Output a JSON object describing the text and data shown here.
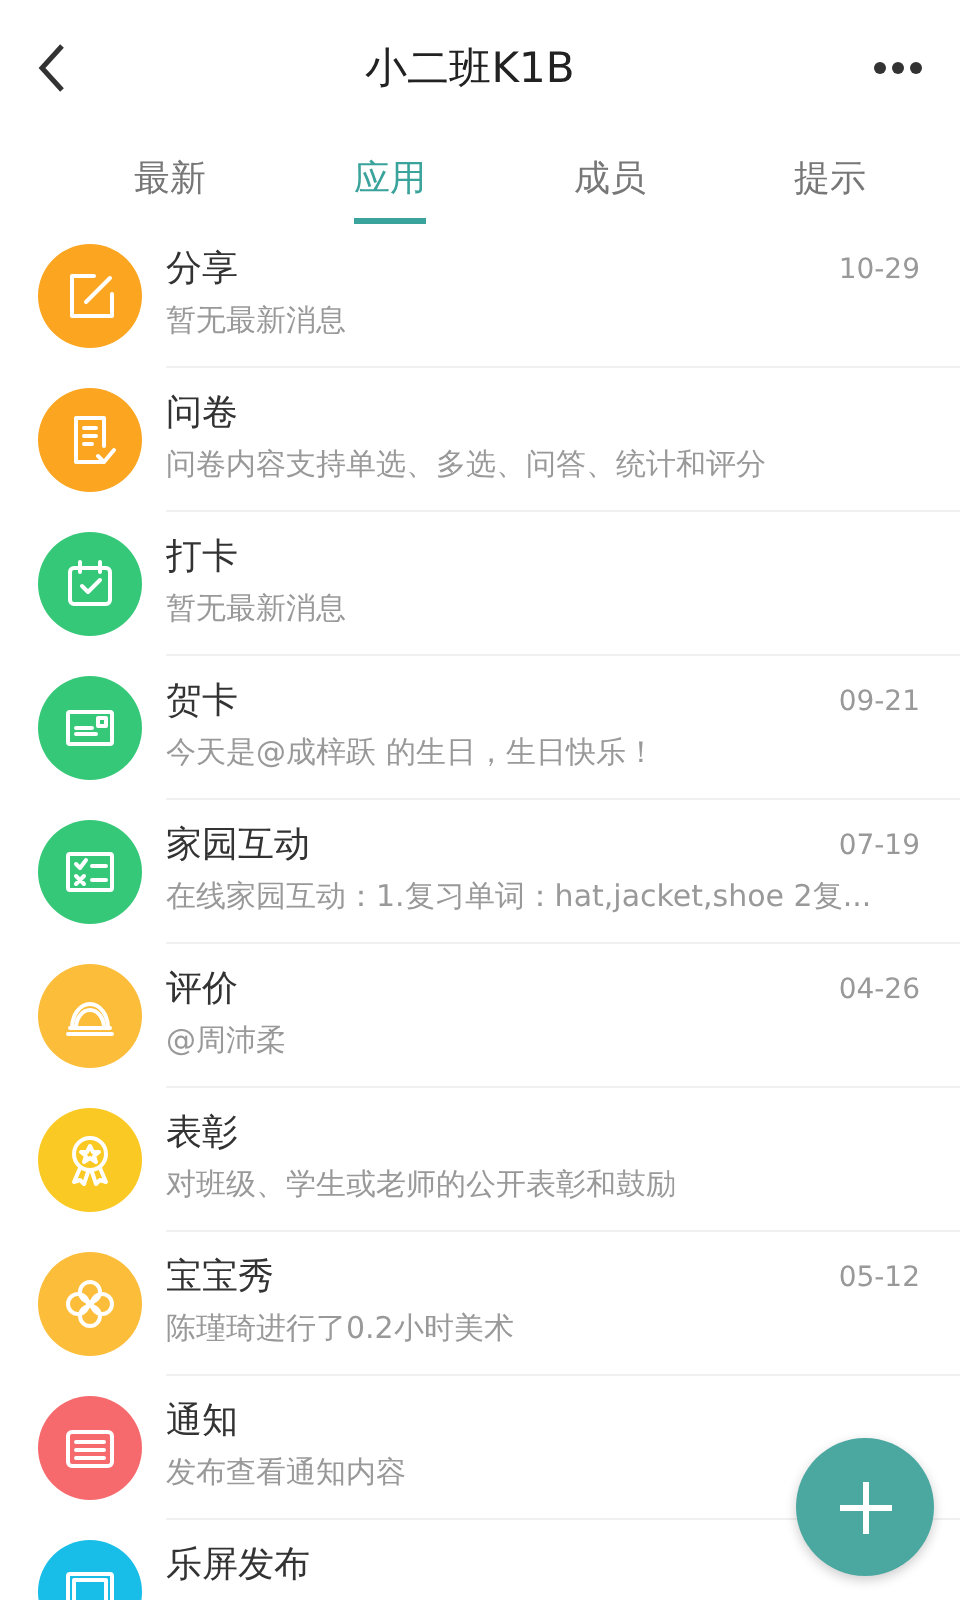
{
  "header": {
    "title": "小二班K1B"
  },
  "tabs": [
    {
      "label": "最新",
      "selected": false
    },
    {
      "label": "应用",
      "selected": true
    },
    {
      "label": "成员",
      "selected": false
    },
    {
      "label": "提示",
      "selected": false
    }
  ],
  "apps": [
    {
      "kind": "edit",
      "color": "#fba520",
      "title": "分享",
      "subtitle": "暂无最新消息",
      "date": "10-29"
    },
    {
      "kind": "form",
      "color": "#fba520",
      "title": "问卷",
      "subtitle": "问卷内容支持单选、多选、问答、统计和评分"
    },
    {
      "kind": "calendar",
      "color": "#35c878",
      "title": "打卡",
      "subtitle": "暂无最新消息"
    },
    {
      "kind": "card",
      "color": "#35c878",
      "title": "贺卡",
      "subtitle": "今天是@成梓跃  的生日，生日快乐！",
      "date": "09-21"
    },
    {
      "kind": "checklist",
      "color": "#35c878",
      "title": "家园互动",
      "subtitle": "在线家园互动：1.复习单词：hat,jacket,shoe 2复...",
      "date": "07-19"
    },
    {
      "kind": "medal",
      "color": "#fbbd3a",
      "title": "评价",
      "subtitle": "@周沛柔",
      "date": "04-26"
    },
    {
      "kind": "award",
      "color": "#fbc923",
      "title": "表彰",
      "subtitle": "对班级、学生或老师的公开表彰和鼓励"
    },
    {
      "kind": "flower",
      "color": "#fbbd3a",
      "title": "宝宝秀",
      "subtitle": "陈瑾琦进行了0.2小时美术",
      "date": "05-12"
    },
    {
      "kind": "notice",
      "color": "#f66a6e",
      "title": "通知",
      "subtitle": "发布查看通知内容"
    },
    {
      "kind": "screen",
      "color": "#18bde8",
      "title": "乐屏发布"
    }
  ]
}
